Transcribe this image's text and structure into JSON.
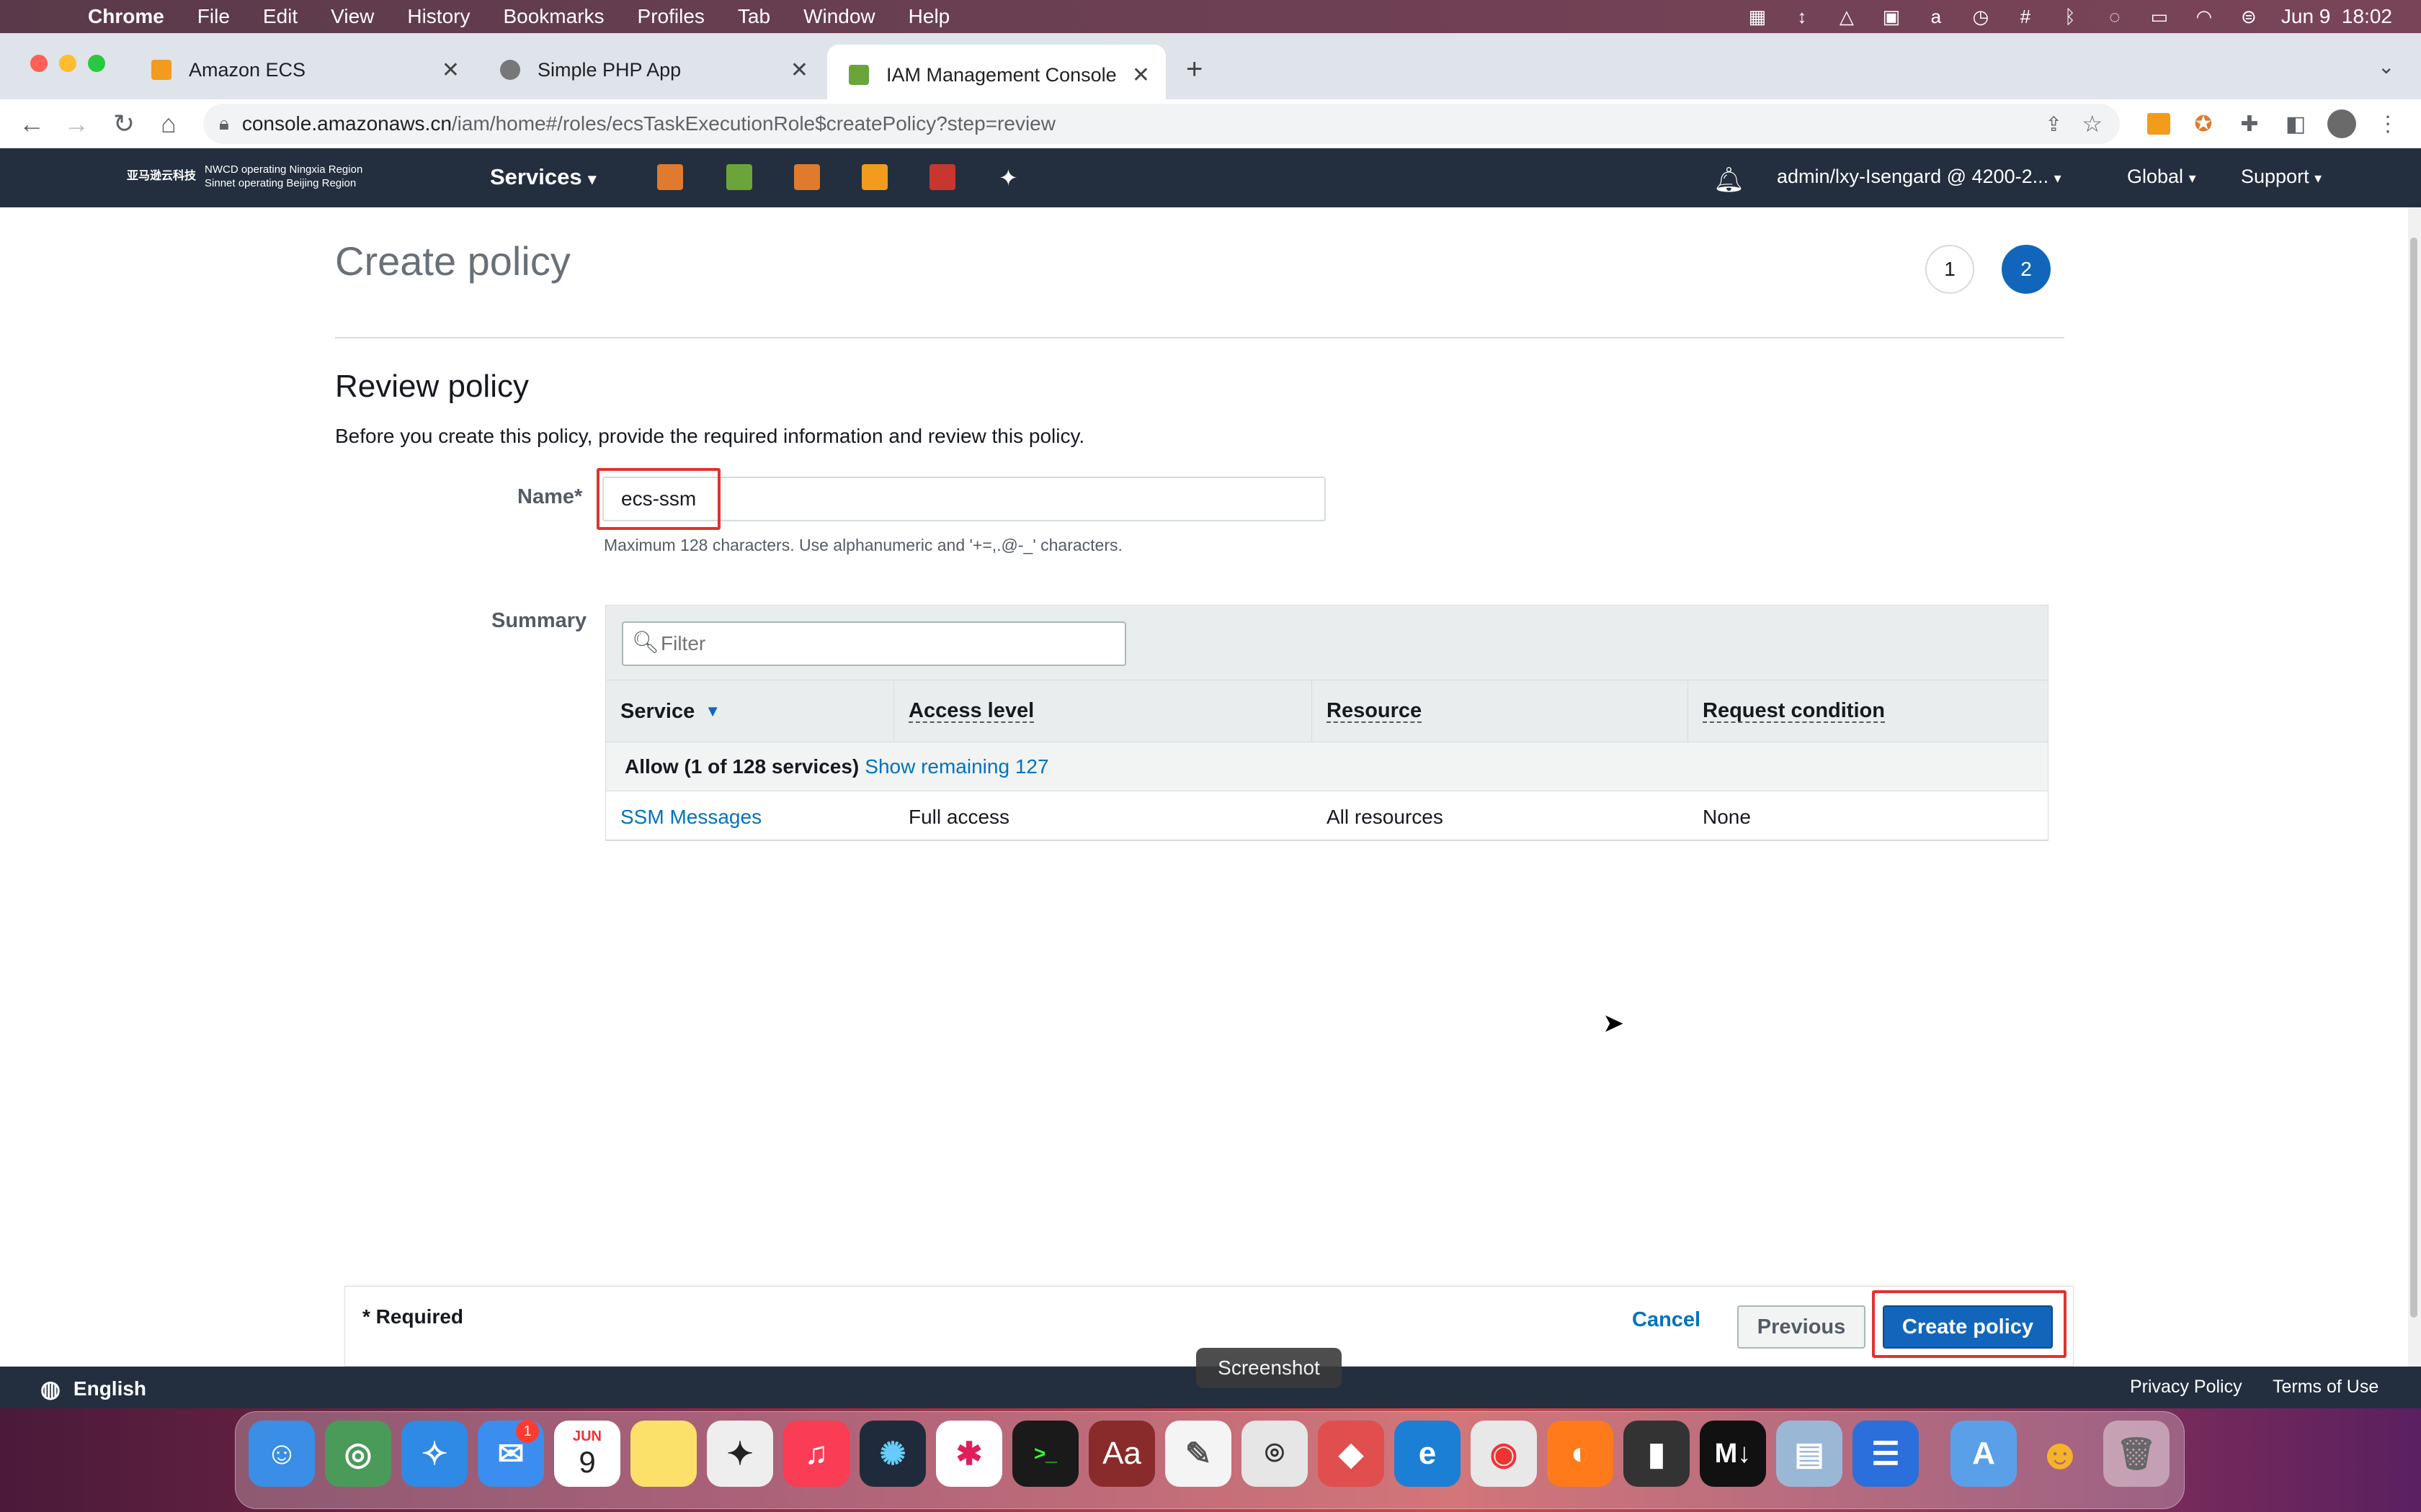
{
  "menubar": {
    "app": "Chrome",
    "items": [
      "File",
      "Edit",
      "View",
      "History",
      "Bookmarks",
      "Profiles",
      "Tab",
      "Window",
      "Help"
    ],
    "datetime": "Jun 9  18:02"
  },
  "tabs": [
    {
      "title": "Amazon ECS"
    },
    {
      "title": "Simple PHP App"
    },
    {
      "title": "IAM Management Console"
    }
  ],
  "address": {
    "domain": "console.amazonaws.cn",
    "path": "/iam/home#/roles/ecsTaskExecutionRole$createPolicy?step=review"
  },
  "awsnav": {
    "logo_cn": "亚马逊云科技",
    "region1": "NWCD operating Ningxia Region",
    "region2": "Sinnet operating Beijing Region",
    "services": "Services",
    "account": "admin/lxy-Isengard @ 4200-2...",
    "region": "Global",
    "support": "Support"
  },
  "page": {
    "title": "Create policy",
    "steps": [
      "1",
      "2"
    ],
    "review_title": "Review policy",
    "review_desc": "Before you create this policy, provide the required information and review this policy.",
    "name_label": "Name*",
    "name_value": "ecs-ssm",
    "name_hint": "Maximum 128 characters. Use alphanumeric and '+=,.@-_' characters.",
    "summary_label": "Summary",
    "filter_placeholder": "Filter",
    "columns": [
      "Service",
      "Access level",
      "Resource",
      "Request condition"
    ],
    "group_label": "Allow (1 of 128 services)",
    "group_link": "Show remaining 127",
    "rows": [
      {
        "service": "SSM Messages",
        "access": "Full access",
        "resource": "All resources",
        "condition": "None"
      }
    ]
  },
  "actions": {
    "required": "* Required",
    "cancel": "Cancel",
    "previous": "Previous",
    "create": "Create policy"
  },
  "footer": {
    "language": "English",
    "privacy": "Privacy Policy",
    "terms": "Terms of Use"
  },
  "dock": {
    "tooltip": "Screenshot",
    "mail_badge": "1",
    "calendar_month": "JUN",
    "calendar_day": "9"
  },
  "colors": {
    "aws_nav": "#232f3e",
    "primary": "#1166bb",
    "link": "#0073bb",
    "highlight": "#e0332e"
  }
}
